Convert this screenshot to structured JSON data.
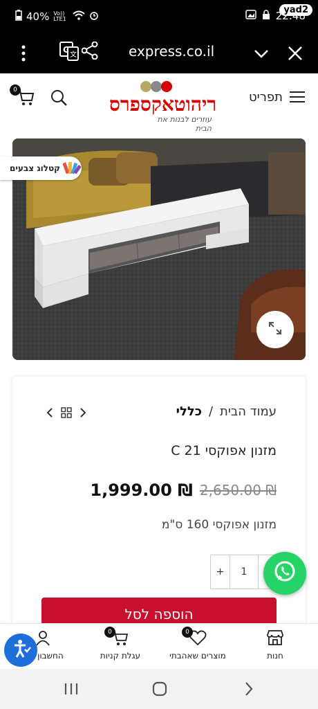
{
  "status_bar": {
    "battery": "40%",
    "time": "22:48",
    "yad2": "yad2",
    "network": "Vo)) LTE1"
  },
  "browser": {
    "url": "express.co.il"
  },
  "header": {
    "logo_text": "ריהוטאקספרס",
    "logo_tagline": "עוזרים לבנות את הבית",
    "menu_label": "תפריט",
    "cart_count": "0"
  },
  "catalog_badge": {
    "label": "קטלוג צבעים"
  },
  "product": {
    "breadcrumb_home": "עמוד הבית",
    "breadcrumb_sep": "/",
    "breadcrumb_current": "כללי",
    "title": "מזנון אפוקסי C 21",
    "old_price": "2,650.00 ₪",
    "new_price": "1,999.00 ₪",
    "description": "מזנון אפוקסי 160 ס\"מ",
    "quantity": "1",
    "plus": "+",
    "add_to_cart": "הוספה לסל"
  },
  "bottom_nav": {
    "shops": "חנות",
    "wishlist": "מוצרים שאהבתי",
    "wishlist_count": "0",
    "cart": "עגלת קניות",
    "cart_count": "0",
    "account": "החשבון שלי"
  },
  "colors": {
    "brand_red": "#c8102e",
    "whatsapp": "#25d366",
    "access_blue": "#1e6fd9"
  }
}
